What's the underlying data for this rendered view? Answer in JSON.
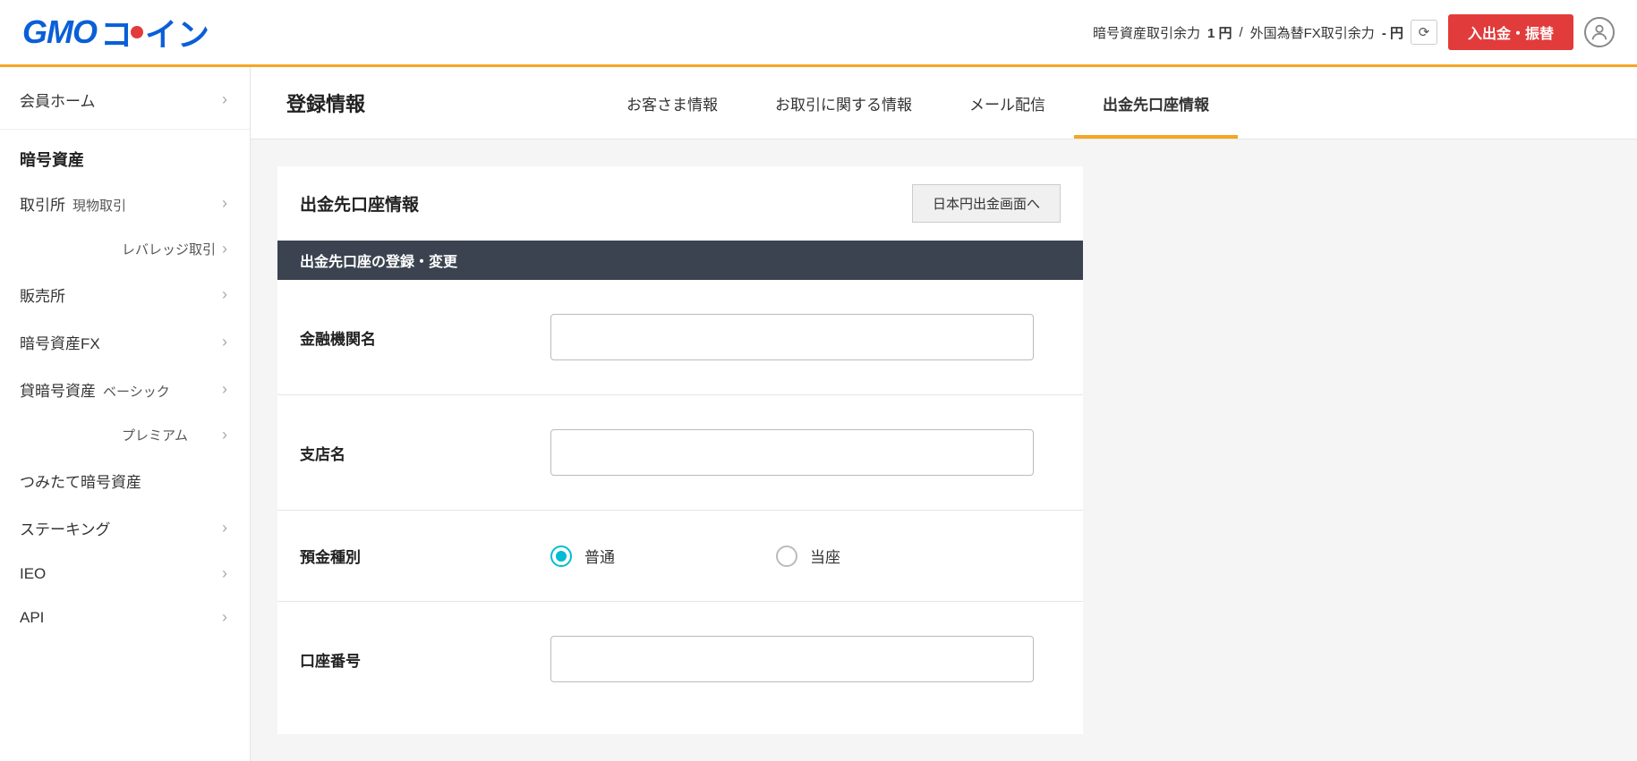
{
  "header": {
    "logo_gmo": "GMO",
    "logo_coin": "コイン",
    "crypto_balance_label": "暗号資産取引余力",
    "crypto_balance_value": "1 円",
    "fx_balance_label": "外国為替FX取引余力",
    "fx_balance_value": "- 円",
    "deposit_btn": "入出金・振替"
  },
  "sidebar": {
    "home": "会員ホーム",
    "section_title": "暗号資産",
    "items": [
      {
        "label": "取引所",
        "sub": "現物取引"
      },
      {
        "sub": "レバレッジ取引",
        "indent": true
      },
      {
        "label": "販売所"
      },
      {
        "label": "暗号資産FX"
      },
      {
        "label": "貸暗号資産",
        "sub": "ベーシック"
      },
      {
        "sub": "プレミアム",
        "indent": true
      },
      {
        "label": "つみたて暗号資産",
        "no_chevron": true
      },
      {
        "label": "ステーキング"
      },
      {
        "label": "IEO"
      },
      {
        "label": "API"
      }
    ]
  },
  "page": {
    "title": "登録情報",
    "tabs": [
      "お客さま情報",
      "お取引に関する情報",
      "メール配信",
      "出金先口座情報"
    ],
    "active_tab": 3
  },
  "panel": {
    "title": "出金先口座情報",
    "jpy_btn": "日本円出金画面へ",
    "section_bar": "出金先口座の登録・変更",
    "fields": {
      "bank_label": "金融機関名",
      "branch_label": "支店名",
      "deposit_type_label": "預金種別",
      "deposit_type_opt1": "普通",
      "deposit_type_opt2": "当座",
      "account_number_label": "口座番号"
    }
  }
}
